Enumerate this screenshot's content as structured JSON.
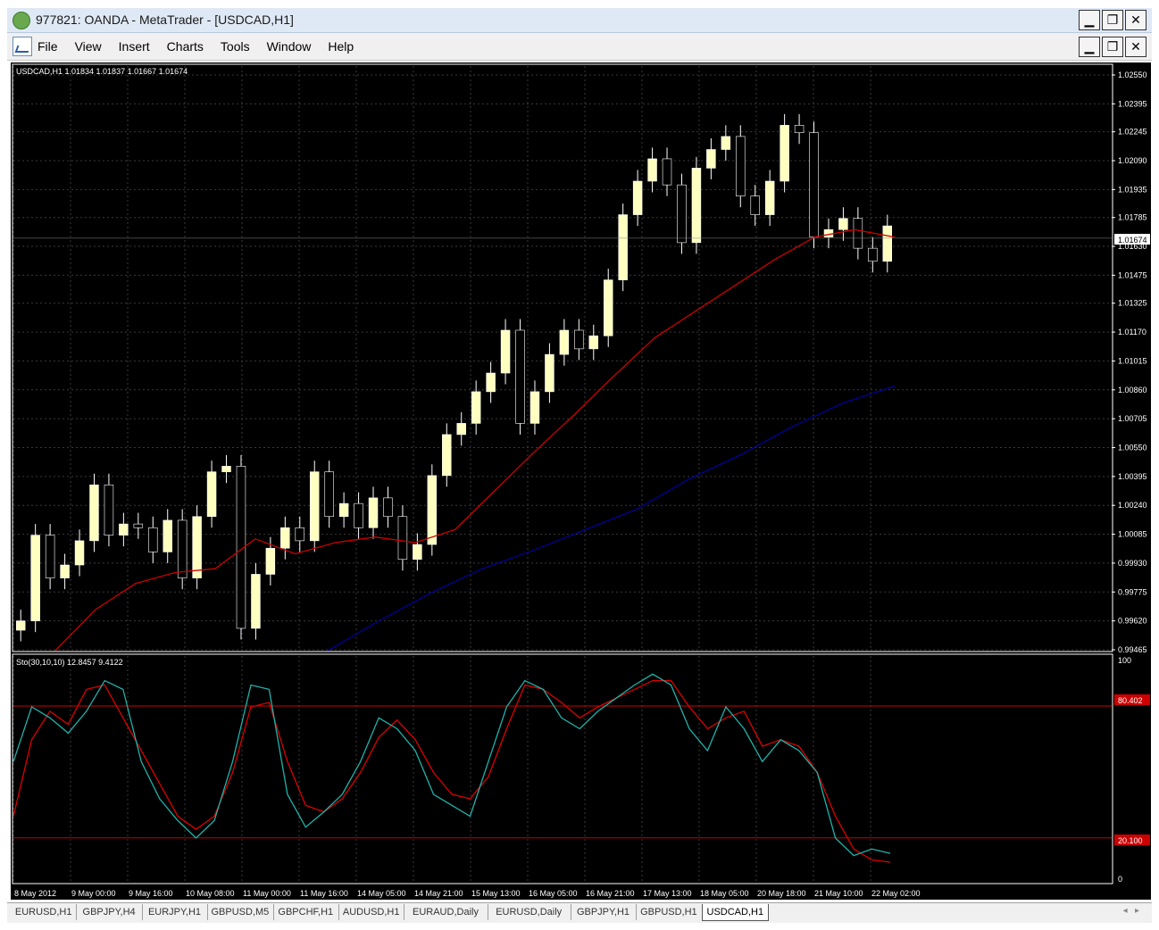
{
  "window": {
    "title": "977821: OANDA - MetaTrader - [USDCAD,H1]"
  },
  "menu": [
    "File",
    "View",
    "Insert",
    "Charts",
    "Tools",
    "Window",
    "Help"
  ],
  "chart": {
    "symbol_info": "USDCAD,H1  1.01834 1.01837 1.01667 1.01674",
    "current_price": "1.01674",
    "price_labels": [
      "1.02550",
      "1.02395",
      "1.02245",
      "1.02090",
      "1.01935",
      "1.01785",
      "1.01630",
      "1.01475",
      "1.01325",
      "1.01170",
      "1.01015",
      "1.00860",
      "1.00705",
      "1.00550",
      "1.00395",
      "1.00240",
      "1.00085",
      "0.99930",
      "0.99775",
      "0.99620",
      "0.99465"
    ],
    "time_labels": [
      "8 May 2012",
      "9 May 00:00",
      "9 May 16:00",
      "10 May 08:00",
      "11 May 00:00",
      "11 May 16:00",
      "14 May 05:00",
      "14 May 21:00",
      "15 May 13:00",
      "16 May 05:00",
      "16 May 21:00",
      "17 May 13:00",
      "18 May 05:00",
      "20 May 18:00",
      "21 May 10:00",
      "22 May 02:00"
    ],
    "colors": {
      "background": "#000000",
      "bull_candle": "#ffffc0",
      "ma_fast": "#cc0000",
      "ma_slow": "#000099",
      "sto_main": "#20b2aa",
      "sto_signal": "#dd0000",
      "level_line": "#cc0000"
    }
  },
  "indicator": {
    "label": "Sto(30,10,10) 12.8457 9.4122",
    "scale_top": "100",
    "scale_bottom": "0",
    "level_high": "80.402",
    "level_low": "20.100"
  },
  "chart_data": [
    {
      "type": "line",
      "title": "USDCAD,H1",
      "ylim": [
        0.99465,
        1.0255
      ],
      "series": [
        {
          "values": [
            0.9962,
            1.0008,
            0.9985,
            0.9992,
            1.0005,
            1.0035,
            1.0008,
            1.0014,
            1.0012,
            0.9999,
            1.0016,
            0.9985,
            1.0018,
            1.0042,
            1.0045,
            0.9958,
            0.9987,
            1.0001,
            1.0012,
            1.0005,
            1.0042,
            1.0018,
            1.0025,
            1.0012,
            1.0028,
            1.0018,
            0.9995,
            1.0003,
            1.004,
            1.0062,
            1.0068,
            1.0085,
            1.0095,
            1.0118,
            1.0068,
            1.0085,
            1.0105,
            1.0118,
            1.0108,
            1.0115,
            1.0145,
            1.018,
            1.0198,
            1.021,
            1.0196,
            1.0165,
            1.0205,
            1.0215,
            1.0222,
            1.019,
            1.018,
            1.0198,
            1.0228,
            1.0224,
            1.0168,
            1.0172,
            1.0178,
            1.0162,
            1.0155,
            1.0174
          ]
        },
        {
          "values": [
            0.9946,
            0.9968,
            0.9982,
            0.9988,
            0.999,
            1.0006,
            0.9998,
            1.0004,
            1.0007,
            1.0004,
            1.0011,
            1.0032,
            1.0053,
            1.0073,
            1.0094,
            1.0114,
            1.0128,
            1.0142,
            1.0156,
            1.0168,
            1.0172,
            1.0168
          ]
        },
        {
          "values": [
            0.9946,
            0.9962,
            0.9977,
            0.999,
            1.0,
            1.0011,
            1.0022,
            1.0038,
            1.0051,
            1.0066,
            1.0079,
            1.0088
          ]
        }
      ]
    },
    {
      "type": "line",
      "title": "Sto(30,10,10)",
      "ylim": [
        0,
        100
      ],
      "series": [
        {
          "values": [
            55,
            80,
            75,
            68,
            78,
            92,
            88,
            55,
            38,
            28,
            20,
            28,
            55,
            90,
            88,
            40,
            25,
            32,
            40,
            55,
            75,
            70,
            60,
            40,
            35,
            30,
            55,
            80,
            92,
            88,
            75,
            70,
            78,
            84,
            90,
            95,
            90,
            70,
            60,
            80,
            70,
            55,
            65,
            60,
            50,
            20,
            12,
            15,
            13
          ]
        },
        {
          "values": [
            30,
            65,
            78,
            72,
            88,
            90,
            75,
            60,
            45,
            30,
            24,
            30,
            50,
            80,
            82,
            55,
            35,
            32,
            38,
            50,
            66,
            74,
            65,
            50,
            40,
            38,
            48,
            70,
            90,
            88,
            82,
            75,
            80,
            84,
            88,
            92,
            92,
            80,
            70,
            75,
            78,
            62,
            65,
            62,
            50,
            30,
            15,
            10,
            9
          ]
        }
      ]
    }
  ],
  "tabs": [
    "EURUSD,H1",
    "GBPJPY,H4",
    "EURJPY,H1",
    "GBPUSD,M5",
    "GBPCHF,H1",
    "AUDUSD,H1",
    "EURAUD,Daily",
    "EURUSD,Daily",
    "GBPJPY,H1",
    "GBPUSD,H1",
    "USDCAD,H1"
  ],
  "active_tab": "USDCAD,H1"
}
